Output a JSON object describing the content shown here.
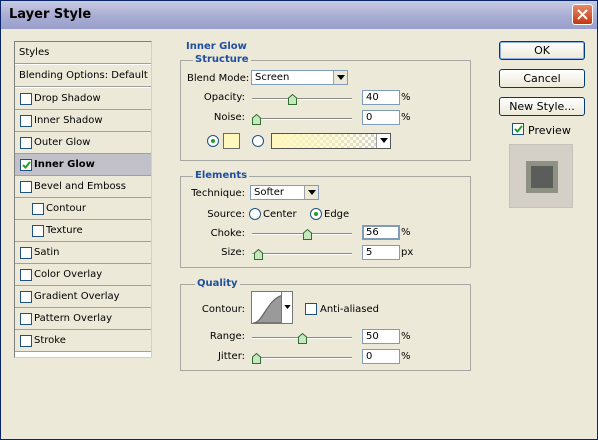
{
  "window": {
    "title": "Layer Style"
  },
  "styles_panel": {
    "header": "Styles",
    "blending": "Blending Options: Default",
    "items": [
      {
        "label": "Drop Shadow",
        "checked": false,
        "selected": false,
        "indent": false
      },
      {
        "label": "Inner Shadow",
        "checked": false,
        "selected": false,
        "indent": false
      },
      {
        "label": "Outer Glow",
        "checked": false,
        "selected": false,
        "indent": false
      },
      {
        "label": "Inner Glow",
        "checked": true,
        "selected": true,
        "indent": false
      },
      {
        "label": "Bevel and Emboss",
        "checked": false,
        "selected": false,
        "indent": false
      },
      {
        "label": "Contour",
        "checked": false,
        "selected": false,
        "indent": true
      },
      {
        "label": "Texture",
        "checked": false,
        "selected": false,
        "indent": true
      },
      {
        "label": "Satin",
        "checked": false,
        "selected": false,
        "indent": false
      },
      {
        "label": "Color Overlay",
        "checked": false,
        "selected": false,
        "indent": false
      },
      {
        "label": "Gradient Overlay",
        "checked": false,
        "selected": false,
        "indent": false
      },
      {
        "label": "Pattern Overlay",
        "checked": false,
        "selected": false,
        "indent": false
      },
      {
        "label": "Stroke",
        "checked": false,
        "selected": false,
        "indent": false
      }
    ]
  },
  "inner_glow": {
    "title": "Inner Glow",
    "structure": {
      "title": "Structure",
      "blend_mode_label": "Blend Mode:",
      "blend_mode_value": "Screen",
      "opacity_label": "Opacity:",
      "opacity_value": "40",
      "opacity_unit": "%",
      "opacity_level": 0.4,
      "noise_label": "Noise:",
      "noise_value": "0",
      "noise_unit": "%",
      "noise_level": 0.0,
      "glow_color": "#fff8bd",
      "color_mode_selected": "color"
    },
    "elements": {
      "title": "Elements",
      "technique_label": "Technique:",
      "technique_value": "Softer",
      "source_label": "Source:",
      "source_center": "Center",
      "source_edge": "Edge",
      "source_selected": "edge",
      "choke_label": "Choke:",
      "choke_value": "56",
      "choke_unit": "%",
      "choke_level": 0.56,
      "size_label": "Size:",
      "size_value": "5",
      "size_unit": "px",
      "size_level": 0.02
    },
    "quality": {
      "title": "Quality",
      "contour_label": "Contour:",
      "anti_aliased_label": "Anti-aliased",
      "anti_aliased": false,
      "range_label": "Range:",
      "range_value": "50",
      "range_unit": "%",
      "range_level": 0.5,
      "jitter_label": "Jitter:",
      "jitter_value": "0",
      "jitter_unit": "%",
      "jitter_level": 0.0
    }
  },
  "buttons": {
    "ok": "OK",
    "cancel": "Cancel",
    "new_style": "New Style..."
  },
  "preview": {
    "label": "Preview",
    "checked": true
  },
  "colors": {
    "title_bar": "#a7acd2",
    "group_title": "#1f4fa0",
    "selected_row": "#c2c1ca",
    "check_green": "#21a121",
    "glow": "#fff8bd"
  },
  "icons": {
    "close": "close-icon",
    "dropdown": "chevron-down-icon",
    "slider_thumb": "slider-thumb-icon",
    "check": "checkmark-icon",
    "contour": "contour-curve-icon"
  }
}
